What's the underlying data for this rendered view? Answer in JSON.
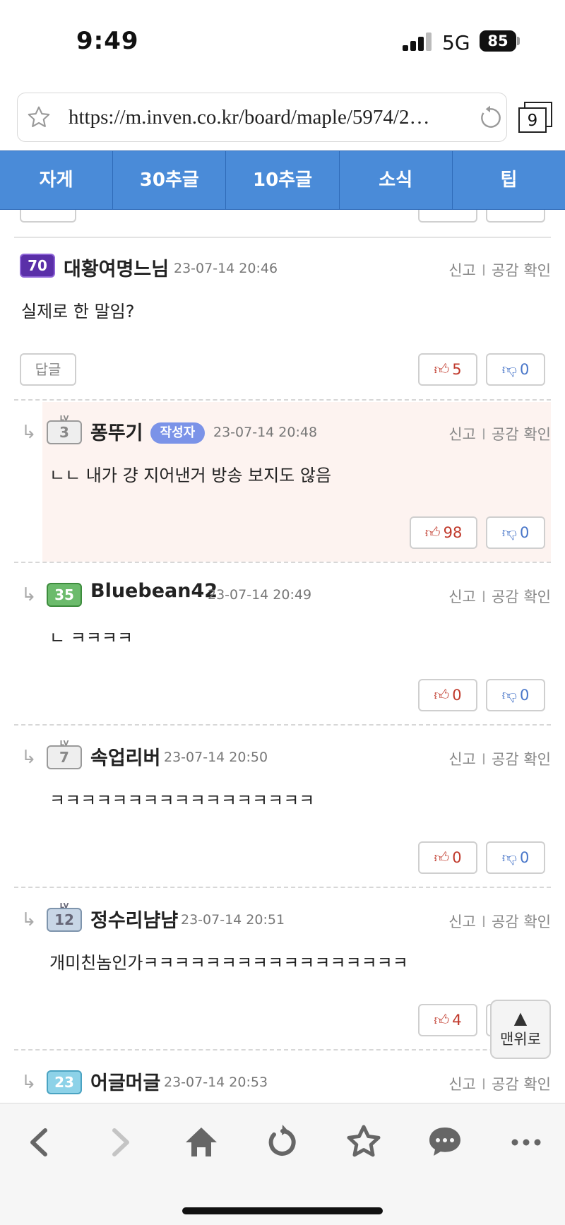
{
  "status_bar": {
    "time": "9:49",
    "network": "5G",
    "battery": "85"
  },
  "browser": {
    "url": "https://m.inven.co.kr/board/maple/5974/2…",
    "tab_count": "9"
  },
  "category_nav": [
    "자게",
    "30추글",
    "10추글",
    "소식",
    "팁"
  ],
  "comments": [
    {
      "level": "70",
      "nick": "대황여명느님",
      "date": "23-07-14 20:46",
      "text": "실제로 한 말임?",
      "reply_label": "답글",
      "up": "5",
      "down": "0"
    },
    {
      "level": "3",
      "nick": "퐁뚜기",
      "badge": "작성자",
      "date": "23-07-14 20:48",
      "text": "ㄴㄴ 내가 걍 지어낸거 방송 보지도 않음",
      "up": "98",
      "down": "0"
    },
    {
      "level": "35",
      "nick": "Bluebean42",
      "date": "23-07-14 20:49",
      "text": "ㄴ ㅋㅋㅋㅋ",
      "up": "0",
      "down": "0"
    },
    {
      "level": "7",
      "nick": "속업리버",
      "date": "23-07-14 20:50",
      "text": "ㅋㅋㅋㅋㅋㅋㅋㅋㅋㅋㅋㅋㅋㅋㅋㅋㅋ",
      "up": "0",
      "down": "0"
    },
    {
      "level": "12",
      "nick": "정수리냠냠",
      "date": "23-07-14 20:51",
      "text": "개미친놈인가ㅋㅋㅋㅋㅋㅋㅋㅋㅋㅋㅋㅋㅋㅋㅋㅋㅋ",
      "up": "4"
    },
    {
      "level": "23",
      "nick": "어글머글",
      "date": "23-07-14 20:53"
    }
  ],
  "actions": {
    "report": "신고",
    "sep": "I",
    "check": "공감 확인"
  },
  "level_prefix": "LV",
  "arrow": "↳",
  "top_button": {
    "label": "맨위로"
  },
  "colors": {
    "nav": "#4a8bd8",
    "author_badge": "#7b93e8",
    "author_bg": "#fdf3f0",
    "upvote": "#c0392b",
    "downvote": "#4a77c9"
  }
}
